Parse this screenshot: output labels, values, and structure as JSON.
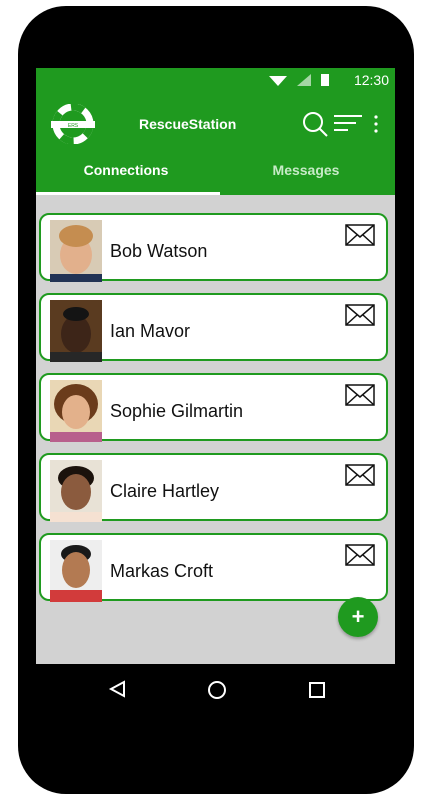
{
  "status": {
    "time": "12:30"
  },
  "app": {
    "title": "RescueStation",
    "logo_text": "ERS"
  },
  "tabs": [
    {
      "label": "Connections",
      "active": true
    },
    {
      "label": "Messages",
      "active": false
    }
  ],
  "contacts": [
    {
      "name": "Bob Watson",
      "avatar_color": "#e2b08c",
      "hair_color": "#c58d50",
      "shirt_color": "#223355"
    },
    {
      "name": "Ian Mavor",
      "avatar_color": "#3d2518",
      "hair_color": "#141414",
      "shirt_color": "#272727"
    },
    {
      "name": "Sophie Gilmartin",
      "avatar_color": "#e3b18b",
      "hair_color": "#6b3c1b",
      "shirt_color": "#b85f8c"
    },
    {
      "name": "Claire Hartley",
      "avatar_color": "#8b5b3e",
      "hair_color": "#1b120c",
      "shirt_color": "#f5e1d2"
    },
    {
      "name": "Markas Croft",
      "avatar_color": "#b37a52",
      "hair_color": "#191919",
      "shirt_color": "#d23b3b"
    }
  ],
  "colors": {
    "primary": "#1f9a1f",
    "background": "#d2d2d2"
  },
  "icons": {
    "search": "search-icon",
    "filter": "filter-icon",
    "more": "more-icon",
    "mail": "mail-icon",
    "add": "plus-icon"
  },
  "fab": {
    "label": "+"
  }
}
